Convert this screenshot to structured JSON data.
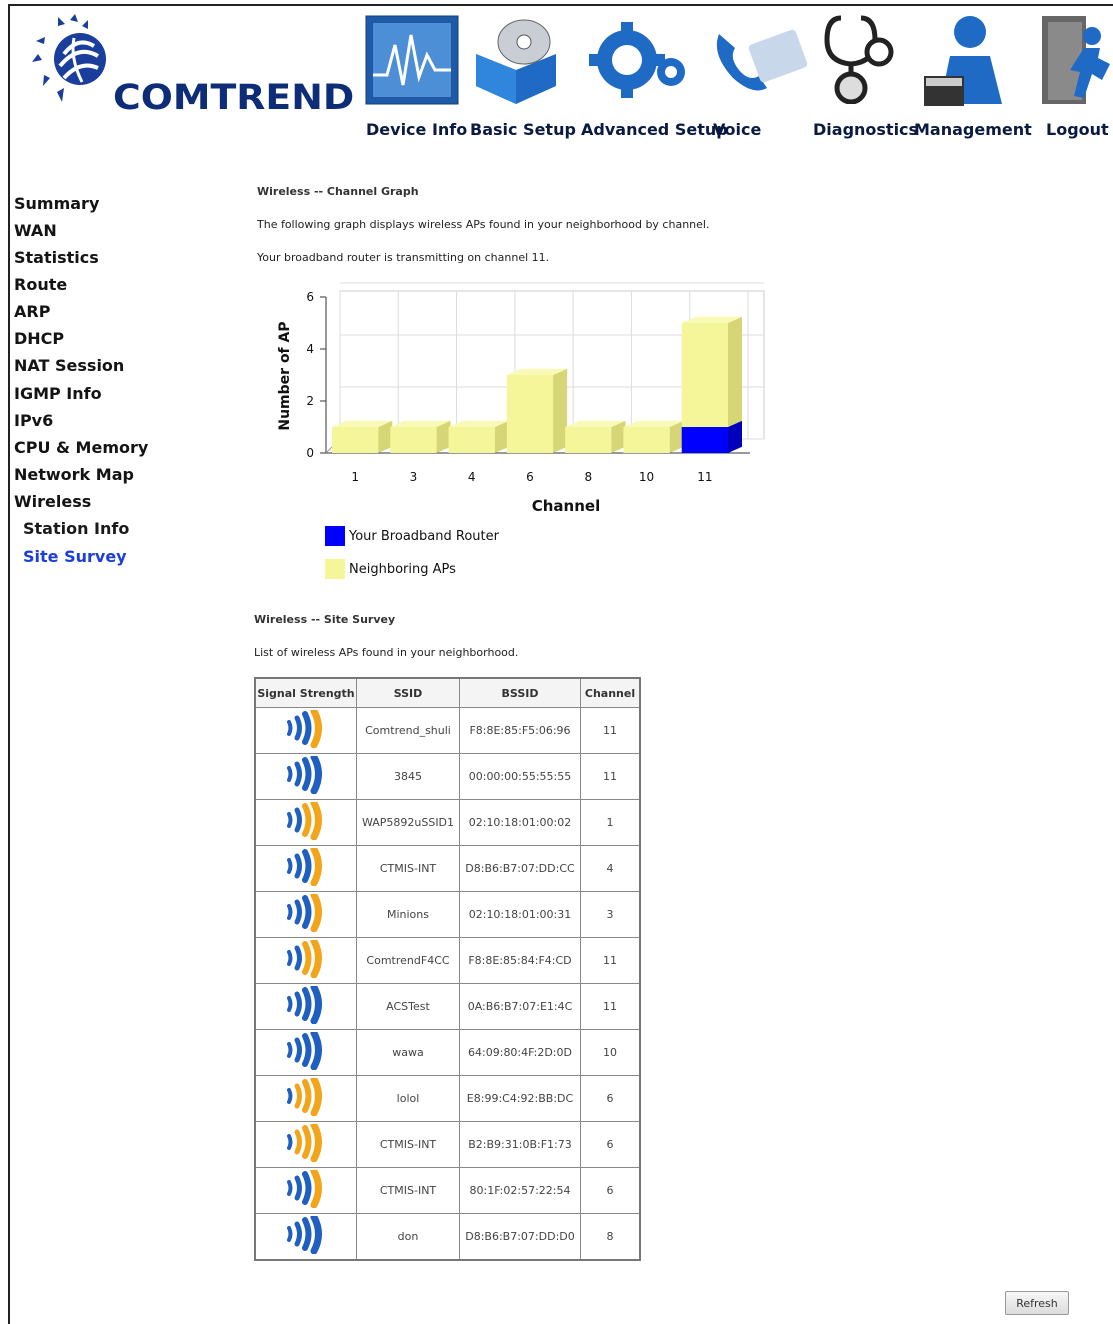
{
  "header": {
    "logo_text": "COMTREND",
    "nav": [
      {
        "label": "Device Info",
        "icon": "device-info-icon"
      },
      {
        "label": "Basic Setup",
        "icon": "basic-setup-icon"
      },
      {
        "label": "Advanced Setup",
        "icon": "advanced-setup-icon"
      },
      {
        "label": "Voice",
        "icon": "voice-icon"
      },
      {
        "label": "Diagnostics",
        "icon": "diagnostics-icon"
      },
      {
        "label": "Management",
        "icon": "management-icon"
      },
      {
        "label": "Logout",
        "icon": "logout-icon"
      }
    ]
  },
  "sidebar": {
    "items": [
      {
        "label": "Summary"
      },
      {
        "label": "WAN"
      },
      {
        "label": "Statistics"
      },
      {
        "label": "Route"
      },
      {
        "label": "ARP"
      },
      {
        "label": "DHCP"
      },
      {
        "label": "NAT Session"
      },
      {
        "label": "IGMP Info"
      },
      {
        "label": "IPv6"
      },
      {
        "label": "CPU & Memory"
      },
      {
        "label": "Network Map"
      },
      {
        "label": "Wireless"
      },
      {
        "label": "Station Info"
      },
      {
        "label": "Site Survey",
        "active": true
      }
    ]
  },
  "graph_section": {
    "title": "Wireless -- Channel Graph",
    "desc": "The following graph displays wireless APs found in your neighborhood by channel.",
    "status": "Your broadband router is transmitting on channel 11."
  },
  "chart_data": {
    "type": "bar",
    "xlabel": "Channel",
    "ylabel": "Number of AP",
    "ylim": [
      0,
      6
    ],
    "yticks": [
      0,
      2,
      4,
      6
    ],
    "categories": [
      "1",
      "3",
      "4",
      "6",
      "8",
      "10",
      "11"
    ],
    "series": [
      {
        "name": "Your Broadband Router",
        "color": "#0000ff",
        "values": [
          0,
          0,
          0,
          0,
          0,
          0,
          1
        ]
      },
      {
        "name": "Neighboring APs",
        "color": "#f5f59a",
        "values": [
          1,
          1,
          1,
          3,
          1,
          1,
          4
        ]
      }
    ],
    "legend_position": "bottom-left",
    "grid": true
  },
  "survey_section": {
    "title": "Wireless -- Site Survey",
    "desc": "List of wireless APs found in your neighborhood.",
    "columns": [
      "Signal Strength",
      "SSID",
      "BSSID",
      "Channel"
    ],
    "rows": [
      {
        "signal": "strong",
        "ssid": "Comtrend_shuli",
        "bssid": "F8:8E:85:F5:06:96",
        "channel": "11"
      },
      {
        "signal": "full",
        "ssid": "3845",
        "bssid": "00:00:00:55:55:55",
        "channel": "11"
      },
      {
        "signal": "medium",
        "ssid": "WAP5892uSSID1",
        "bssid": "02:10:18:01:00:02",
        "channel": "1"
      },
      {
        "signal": "strong",
        "ssid": "CTMIS-INT",
        "bssid": "D8:B6:B7:07:DD:CC",
        "channel": "4"
      },
      {
        "signal": "strong",
        "ssid": "Minions",
        "bssid": "02:10:18:01:00:31",
        "channel": "3"
      },
      {
        "signal": "medium",
        "ssid": "ComtrendF4CC",
        "bssid": "F8:8E:85:84:F4:CD",
        "channel": "11"
      },
      {
        "signal": "full",
        "ssid": "ACSTest",
        "bssid": "0A:B6:B7:07:E1:4C",
        "channel": "11"
      },
      {
        "signal": "full",
        "ssid": "wawa",
        "bssid": "64:09:80:4F:2D:0D",
        "channel": "10"
      },
      {
        "signal": "weak",
        "ssid": "lolol",
        "bssid": "E8:99:C4:92:BB:DC",
        "channel": "6"
      },
      {
        "signal": "weak",
        "ssid": "CTMIS-INT",
        "bssid": "B2:B9:31:0B:F1:73",
        "channel": "6"
      },
      {
        "signal": "strong",
        "ssid": "CTMIS-INT",
        "bssid": "80:1F:02:57:22:54",
        "channel": "6"
      },
      {
        "signal": "full",
        "ssid": "don",
        "bssid": "D8:B6:B7:07:DD:D0",
        "channel": "8"
      }
    ]
  },
  "refresh_label": "Refresh",
  "colors": {
    "brand": "#0d2d78",
    "active_link": "#1b3fd8",
    "sidebar_bg": "#ffffff",
    "signal_blue": "#1f5fbf",
    "signal_orange": "#f2a51a"
  }
}
